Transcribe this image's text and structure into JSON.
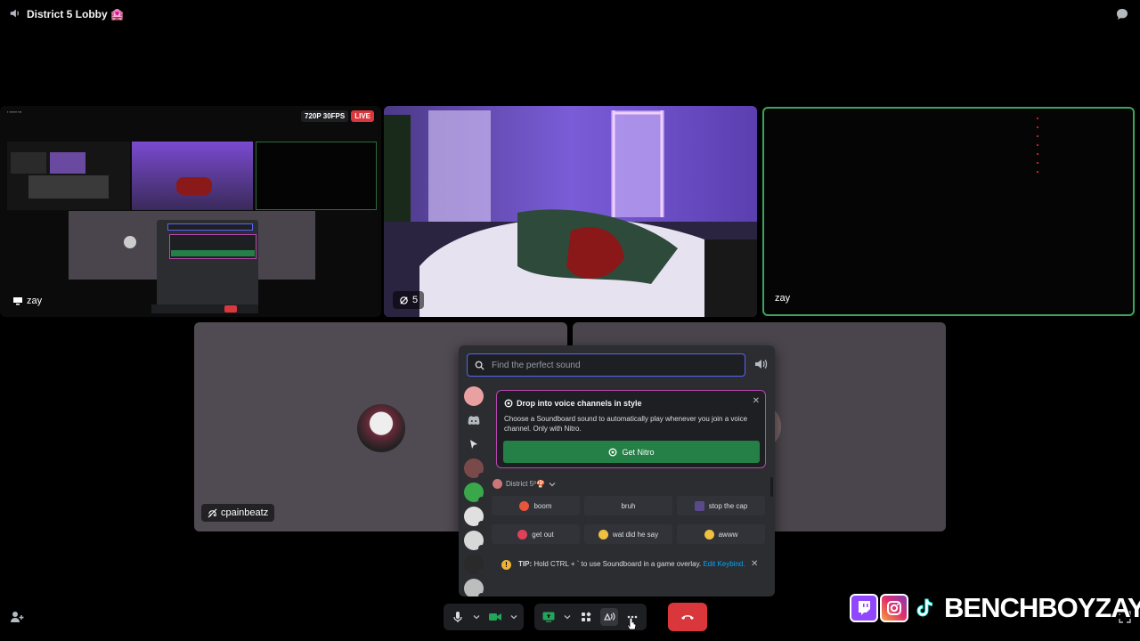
{
  "header": {
    "channel_title": "District 5 Lobby 🏩",
    "icons": [
      "speaker-icon",
      "chat-bubble-icon"
    ]
  },
  "tiles": {
    "screenshare": {
      "quality": "720P 30FPS",
      "live": "LIVE",
      "name": "zay"
    },
    "camera": {
      "watchers": "5"
    },
    "dark": {
      "name": "zay",
      "active_border_color": "#3ba55c"
    },
    "grey1": {
      "name": "cpainbeatz"
    }
  },
  "soundboard": {
    "search_placeholder": "Find the perfect sound",
    "promo": {
      "title": "Drop into voice channels in style",
      "body": "Choose a Soundboard sound to automatically play whenever you join a voice channel. Only with Nitro.",
      "button": "Get Nitro"
    },
    "section_title": "District 5º🍄",
    "sounds": [
      {
        "label": "boom",
        "emoji_color": "#e8553b"
      },
      {
        "label": "bruh",
        "emoji_color": ""
      },
      {
        "label": "stop the cap",
        "emoji_color": "#5a4a8a"
      },
      {
        "label": "get out",
        "emoji_color": "#e0405a"
      },
      {
        "label": "wat did he say",
        "emoji_color": "#f0c040"
      },
      {
        "label": "awww",
        "emoji_color": "#f0c040"
      }
    ],
    "tip": {
      "prefix": "TIP:",
      "text": " Hold CTRL + ` to use Soundboard in a game overlay. ",
      "link": "Edit Keybind."
    }
  },
  "brand": {
    "text": "BENCHBOYZAY",
    "colors": {
      "twitch": "#9146ff",
      "instagram": "#e1306c"
    }
  },
  "colors": {
    "blurple": "#5865f2",
    "green": "#248046",
    "red": "#da373c",
    "nitro_border": "#b847b0"
  }
}
